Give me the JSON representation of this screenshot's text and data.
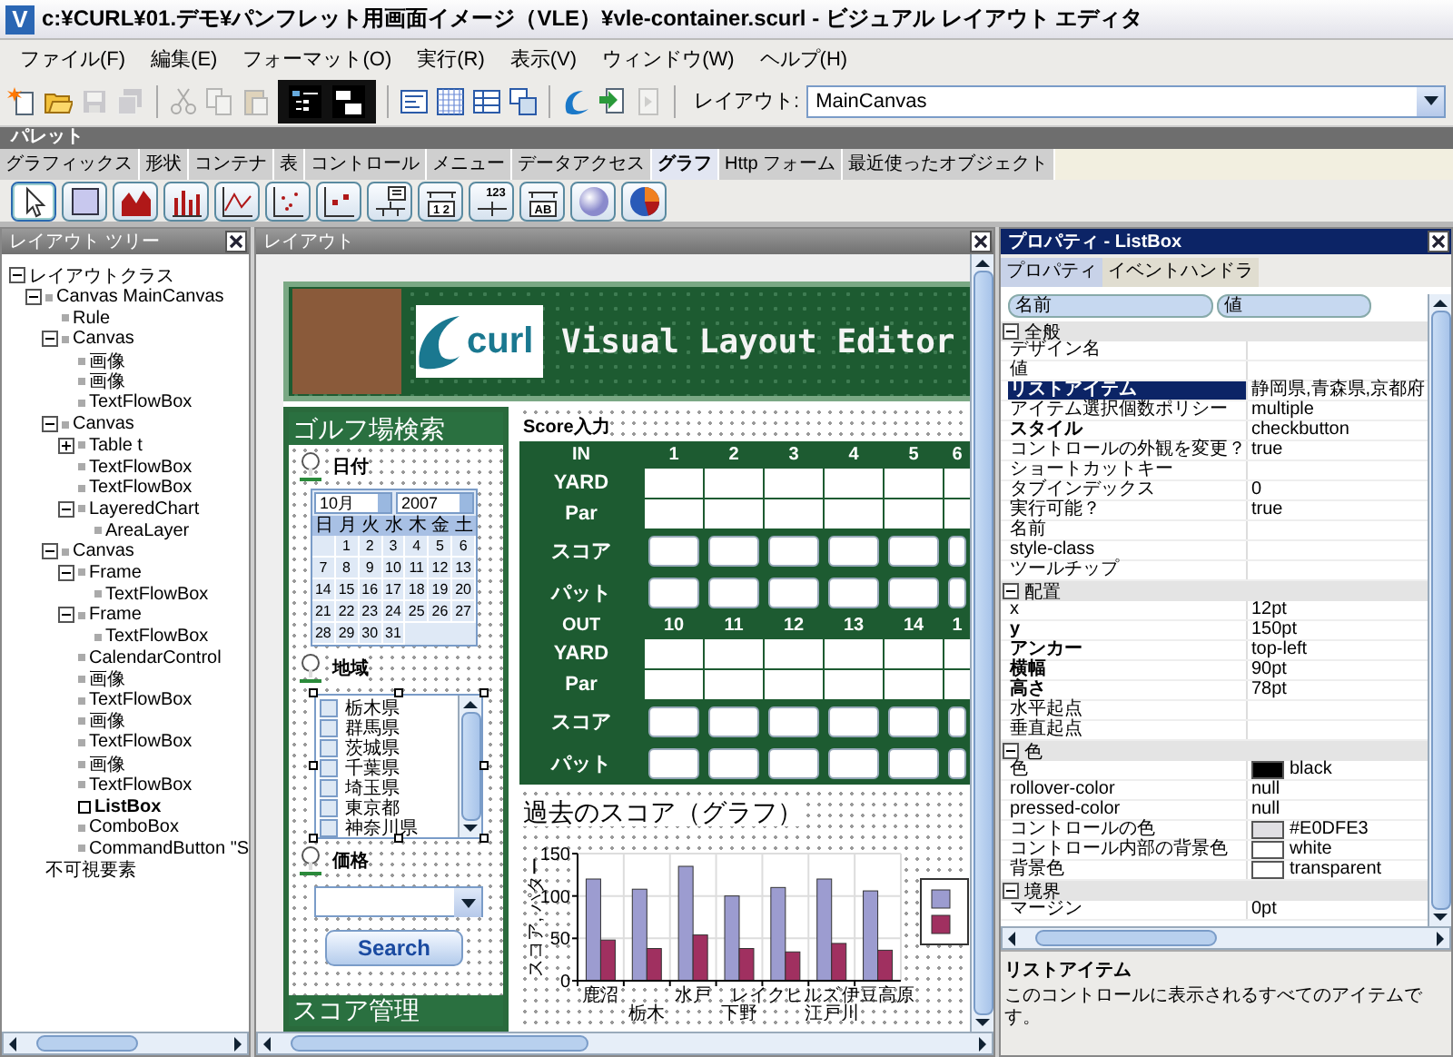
{
  "window": {
    "icon_letter": "V",
    "title": "c:¥CURL¥01.デモ¥パンフレット用画面イメージ（VLE）¥vle-container.scurl - ビジュアル レイアウト エディタ"
  },
  "menu": [
    "ファイル(F)",
    "編集(E)",
    "フォーマット(O)",
    "実行(R)",
    "表示(V)",
    "ウィンドウ(W)",
    "ヘルプ(H)"
  ],
  "toolbar": {
    "items": [
      {
        "kind": "new",
        "disabled": false
      },
      {
        "kind": "open",
        "disabled": false
      },
      {
        "kind": "save",
        "disabled": true
      },
      {
        "kind": "save-all",
        "disabled": true
      },
      {
        "kind": "separator"
      },
      {
        "kind": "cut",
        "disabled": true
      },
      {
        "kind": "copy",
        "disabled": true
      },
      {
        "kind": "paste",
        "disabled": true
      },
      {
        "kind": "toggles"
      },
      {
        "kind": "separator"
      },
      {
        "kind": "form",
        "disabled": false
      },
      {
        "kind": "grid",
        "disabled": false
      },
      {
        "kind": "table",
        "disabled": false
      },
      {
        "kind": "windows",
        "disabled": false
      },
      {
        "kind": "separator"
      },
      {
        "kind": "swirl",
        "disabled": false
      },
      {
        "kind": "run",
        "disabled": false
      },
      {
        "kind": "step",
        "disabled": true
      },
      {
        "kind": "separator"
      }
    ],
    "view_toggles": [
      {
        "kind": "outline",
        "on": true
      },
      {
        "kind": "panes",
        "on": true
      }
    ],
    "layout_label": "レイアウト:",
    "layout_value": "MainCanvas"
  },
  "palette": {
    "title": "パレット",
    "tabs": [
      {
        "label": "グラフィックス",
        "selected": false
      },
      {
        "label": "形状",
        "selected": false
      },
      {
        "label": "コンテナ",
        "selected": false
      },
      {
        "label": "表",
        "selected": false
      },
      {
        "label": "コントロール",
        "selected": false
      },
      {
        "label": "メニュー",
        "selected": false
      },
      {
        "label": "データアクセス",
        "selected": false
      },
      {
        "label": "グラフ",
        "selected": true
      },
      {
        "label": "Http フォーム",
        "selected": false
      },
      {
        "label": "最近使ったオブジェクト",
        "selected": false
      }
    ],
    "tools": [
      {
        "kind": "pointer",
        "selected": true
      },
      {
        "kind": "rect",
        "selected": false
      },
      {
        "kind": "area",
        "selected": false
      },
      {
        "kind": "bar",
        "selected": false
      },
      {
        "kind": "line",
        "selected": false
      },
      {
        "kind": "scatter",
        "selected": false
      },
      {
        "kind": "scatter2",
        "selected": false
      },
      {
        "kind": "legend",
        "selected": false
      },
      {
        "kind": "axis",
        "label": "1 2",
        "selected": false
      },
      {
        "kind": "axis-count",
        "label": "123",
        "selected": false
      },
      {
        "kind": "axis",
        "label": "AB",
        "selected": false
      },
      {
        "kind": "sphere",
        "selected": false
      },
      {
        "kind": "pie",
        "selected": false
      }
    ]
  },
  "layout_tree": {
    "title": "レイアウト ツリー",
    "items": [
      {
        "label": "レイアウトクラス",
        "kind": "class",
        "selected": false,
        "expanded": true,
        "children": [
          {
            "label": "Canvas MainCanvas",
            "kind": "node",
            "selected": false,
            "expanded": true,
            "children": [
              {
                "label": "Rule",
                "kind": "node",
                "selected": false
              },
              {
                "label": "Canvas",
                "kind": "node",
                "selected": false,
                "expanded": true,
                "children": [
                  {
                    "label": "画像",
                    "kind": "node",
                    "selected": false
                  },
                  {
                    "label": "画像",
                    "kind": "node",
                    "selected": false
                  },
                  {
                    "label": "TextFlowBox",
                    "kind": "node",
                    "selected": false
                  }
                ]
              },
              {
                "label": "Canvas",
                "kind": "node",
                "selected": false,
                "expanded": true,
                "children": [
                  {
                    "label": "Table t",
                    "kind": "node",
                    "selected": false,
                    "expanded": false
                  },
                  {
                    "label": "TextFlowBox",
                    "kind": "node",
                    "selected": false
                  },
                  {
                    "label": "TextFlowBox",
                    "kind": "node",
                    "selected": false
                  },
                  {
                    "label": "LayeredChart",
                    "kind": "node",
                    "selected": false,
                    "expanded": true,
                    "children": [
                      {
                        "label": "AreaLayer",
                        "kind": "node",
                        "selected": false
                      }
                    ]
                  }
                ]
              },
              {
                "label": "Canvas",
                "kind": "node",
                "selected": false,
                "expanded": true,
                "children": [
                  {
                    "label": "Frame",
                    "kind": "node",
                    "selected": false,
                    "expanded": true,
                    "children": [
                      {
                        "label": "TextFlowBox",
                        "kind": "node",
                        "selected": false
                      }
                    ]
                  },
                  {
                    "label": "Frame",
                    "kind": "node",
                    "selected": false,
                    "expanded": true,
                    "children": [
                      {
                        "label": "TextFlowBox",
                        "kind": "node",
                        "selected": false
                      }
                    ]
                  },
                  {
                    "label": "CalendarControl",
                    "kind": "node",
                    "selected": false
                  },
                  {
                    "label": "画像",
                    "kind": "node",
                    "selected": false
                  },
                  {
                    "label": "TextFlowBox",
                    "kind": "node",
                    "selected": false
                  },
                  {
                    "label": "画像",
                    "kind": "node",
                    "selected": false
                  },
                  {
                    "label": "TextFlowBox",
                    "kind": "node",
                    "selected": false
                  },
                  {
                    "label": "画像",
                    "kind": "node",
                    "selected": false
                  },
                  {
                    "label": "TextFlowBox",
                    "kind": "node",
                    "selected": false
                  },
                  {
                    "label": "ListBox",
                    "kind": "node",
                    "selected": true
                  },
                  {
                    "label": "ComboBox",
                    "kind": "node",
                    "selected": false
                  },
                  {
                    "label": "CommandButton \"S",
                    "kind": "node",
                    "selected": false
                  }
                ]
              }
            ]
          },
          {
            "label": "不可視要素",
            "kind": "class",
            "selected": false
          }
        ]
      }
    ]
  },
  "layout": {
    "title": "レイアウト",
    "design": {
      "banner_title": "Visual Layout Editor",
      "logo_text": "curl",
      "search": {
        "title": "ゴルフ場検索",
        "date_label": "日付",
        "month": "10月",
        "year": "2007",
        "weekdays": [
          "日",
          "月",
          "火",
          "水",
          "木",
          "金",
          "土"
        ],
        "weeks": [
          [
            "1",
            "2",
            "3",
            "4",
            "5",
            "6"
          ],
          [
            "7",
            "8",
            "9",
            "10",
            "11",
            "12",
            "13"
          ],
          [
            "14",
            "15",
            "16",
            "17",
            "18",
            "19",
            "20"
          ],
          [
            "21",
            "22",
            "23",
            "24",
            "25",
            "26",
            "27"
          ],
          [
            "28",
            "29",
            "30",
            "31"
          ]
        ],
        "region_label": "地域",
        "regions": [
          {
            "label": "栃木県",
            "checked": false
          },
          {
            "label": "群馬県",
            "checked": false
          },
          {
            "label": "茨城県",
            "checked": false
          },
          {
            "label": "千葉県",
            "checked": false
          },
          {
            "label": "埼玉県",
            "checked": false
          },
          {
            "label": "東京都",
            "checked": false
          },
          {
            "label": "神奈川県",
            "checked": false
          }
        ],
        "price_label": "価格",
        "search_button": "Search",
        "footer": "スコア管理"
      },
      "score": {
        "title": "Score入力",
        "sections": [
          {
            "header": "IN",
            "holes": [
              "1",
              "2",
              "3",
              "4",
              "5",
              "6"
            ],
            "rows": [
              {
                "label": "YARD",
                "kind": "text"
              },
              {
                "label": "Par",
                "kind": "text"
              },
              {
                "label": "スコア",
                "kind": "input"
              },
              {
                "label": "パット",
                "kind": "input"
              }
            ]
          },
          {
            "header": "OUT",
            "holes": [
              "10",
              "11",
              "12",
              "13",
              "14",
              "1"
            ],
            "rows": [
              {
                "label": "YARD",
                "kind": "text"
              },
              {
                "label": "Par",
                "kind": "text"
              },
              {
                "label": "スコア",
                "kind": "input"
              },
              {
                "label": "パット",
                "kind": "input"
              }
            ]
          }
        ]
      },
      "chart": {
        "title": "過去のスコア（グラフ）",
        "chart_data": {
          "type": "bar",
          "ylabel": "スコア, パター",
          "categories": [
            "鹿沼",
            "栃木",
            "水戸",
            "下野",
            "レイクヒルズ",
            "江戸川",
            "伊豆高原"
          ],
          "series": [
            {
              "color": "#9c9cd0",
              "values": [
                120,
                108,
                135,
                100,
                110,
                120,
                106
              ]
            },
            {
              "color": "#a03060",
              "values": [
                48,
                38,
                54,
                38,
                34,
                44,
                36
              ]
            }
          ],
          "ylim": [
            0,
            150
          ],
          "yticks": [
            0,
            50,
            100,
            150
          ]
        }
      }
    }
  },
  "properties": {
    "title": "プロパティ - ListBox",
    "tabs": [
      {
        "label": "プロパティ",
        "selected": true
      },
      {
        "label": "イベントハンドラ",
        "selected": false
      }
    ],
    "columns": [
      "名前",
      "値"
    ],
    "groups": [
      {
        "name": "全般",
        "expanded": true,
        "rows": [
          {
            "name": "デザイン名",
            "bold": false,
            "selected": false
          },
          {
            "name": "値",
            "bold": false,
            "selected": false
          },
          {
            "name": "リストアイテム",
            "value": "静岡県,青森県,京都府",
            "bold": true,
            "selected": true
          },
          {
            "name": "アイテム選択個数ポリシー",
            "value": "multiple",
            "bold": false,
            "selected": false
          },
          {
            "name": "スタイル",
            "value": "checkbutton",
            "bold": true,
            "selected": false
          },
          {
            "name": "コントロールの外観を変更？",
            "value": "true",
            "bold": false,
            "selected": false
          },
          {
            "name": "ショートカットキー",
            "bold": false,
            "selected": false
          },
          {
            "name": "タブインデックス",
            "value": "0",
            "bold": false,
            "selected": false
          },
          {
            "name": "実行可能？",
            "value": "true",
            "bold": false,
            "selected": false
          },
          {
            "name": "名前",
            "bold": false,
            "selected": false
          },
          {
            "name": "style-class",
            "bold": false,
            "selected": false
          },
          {
            "name": "ツールチップ",
            "bold": false,
            "selected": false
          }
        ]
      },
      {
        "name": "配置",
        "expanded": true,
        "rows": [
          {
            "name": "x",
            "value": "12pt",
            "bold": false,
            "selected": false
          },
          {
            "name": "y",
            "value": "150pt",
            "bold": true,
            "selected": false
          },
          {
            "name": "アンカー",
            "value": "top-left",
            "bold": true,
            "selected": false
          },
          {
            "name": "横幅",
            "value": "90pt",
            "bold": true,
            "selected": false
          },
          {
            "name": "高さ",
            "value": "78pt",
            "bold": true,
            "selected": false
          },
          {
            "name": "水平起点",
            "bold": false,
            "selected": false
          },
          {
            "name": "垂直起点",
            "bold": false,
            "selected": false
          }
        ]
      },
      {
        "name": "色",
        "expanded": true,
        "rows": [
          {
            "name": "色",
            "value": "black",
            "color": "#000000",
            "bold": false,
            "selected": false
          },
          {
            "name": "rollover-color",
            "value": "null",
            "bold": false,
            "selected": false
          },
          {
            "name": "pressed-color",
            "value": "null",
            "bold": false,
            "selected": false
          },
          {
            "name": "コントロールの色",
            "value": "#E0DFE3",
            "color": "#e0dfe3",
            "bold": false,
            "selected": false
          },
          {
            "name": "コントロール内部の背景色",
            "value": "white",
            "color": "#ffffff",
            "bold": false,
            "selected": false
          },
          {
            "name": "背景色",
            "value": "transparent",
            "color": "#ffffff",
            "bold": false,
            "selected": false
          }
        ]
      },
      {
        "name": "境界",
        "expanded": true,
        "rows": [
          {
            "name": "マージン",
            "value": "0pt",
            "bold": false,
            "selected": false
          }
        ]
      }
    ],
    "description": {
      "title": "リストアイテム",
      "text": "このコントロールに表示されるすべてのアイテムです。"
    }
  }
}
